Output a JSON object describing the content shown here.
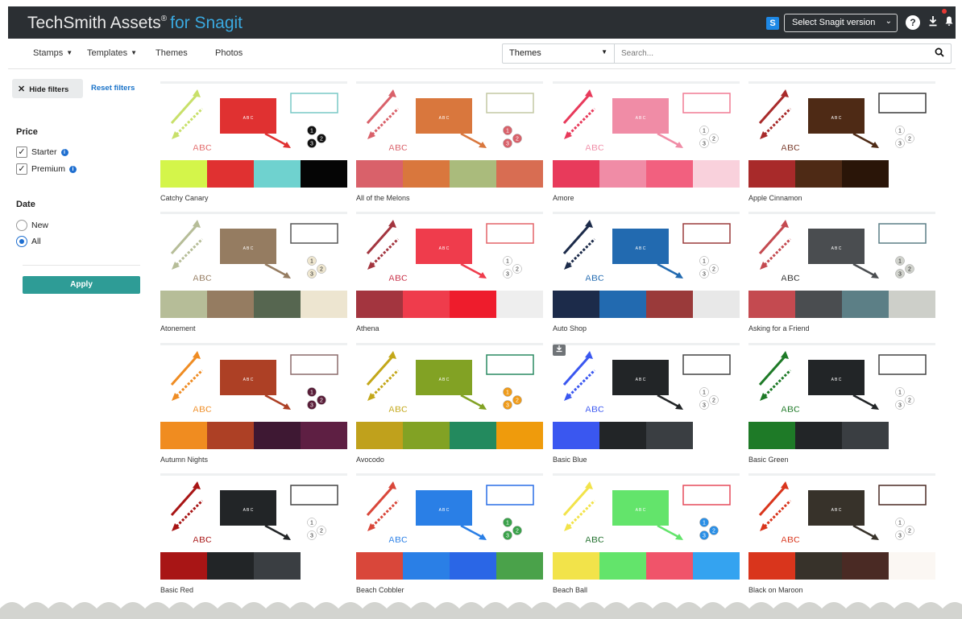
{
  "header": {
    "brand": "TechSmith Assets",
    "brand_reg": "®",
    "brand_suffix": "for Snagit",
    "snagit_badge": "S",
    "version_select": "Select Snagit version",
    "icons": [
      "snagit-logo-icon",
      "chevron-down-icon",
      "help-icon",
      "download-icon",
      "notification-bell-icon"
    ]
  },
  "nav": {
    "items": [
      {
        "label": "Stamps",
        "has_menu": true
      },
      {
        "label": "Templates",
        "has_menu": true
      },
      {
        "label": "Themes",
        "has_menu": false
      },
      {
        "label": "Photos",
        "has_menu": false
      }
    ],
    "search_type": "Themes",
    "search_placeholder": "Search..."
  },
  "sidebar": {
    "hide_filters": "Hide filters",
    "reset_filters": "Reset filters",
    "price_title": "Price",
    "price_options": [
      {
        "label": "Starter",
        "checked": true
      },
      {
        "label": "Premium",
        "checked": true
      }
    ],
    "date_title": "Date",
    "date_options": [
      {
        "label": "New",
        "selected": false
      },
      {
        "label": "All",
        "selected": true
      }
    ],
    "apply": "Apply"
  },
  "themes": [
    {
      "name": "Catchy Canary",
      "arrow": "#c8e06a",
      "box": "#e03131",
      "outline": "#78c8c6",
      "step": "#111111",
      "text": "#e26a6a",
      "colors": [
        "#d4f54a",
        "#e03131",
        "#6fd2cf",
        "#050505"
      ]
    },
    {
      "name": "All of the Melons",
      "arrow": "#d9616a",
      "box": "#d9773d",
      "outline": "#c3c9a4",
      "step": "#d9616a",
      "text": "#d9616a",
      "colors": [
        "#d9616a",
        "#d9773d",
        "#aabb7c",
        "#d86d52"
      ]
    },
    {
      "name": "Amore",
      "arrow": "#e83a5b",
      "box": "#f08ca6",
      "outline": "#f07a93",
      "step": "#ffffff",
      "text": "#f08ca6",
      "colors": [
        "#e83a5b",
        "#f08ca6",
        "#f2607f",
        "#f9d1dc"
      ]
    },
    {
      "name": "Apple Cinnamon",
      "arrow": "#a82a2a",
      "box": "#4e2a15",
      "outline": "#3a3a3a",
      "step": "#ffffff",
      "text": "#7a3b2b",
      "colors": [
        "#a82a2a",
        "#4e2a15",
        "#2a1508",
        "#ffffff"
      ]
    },
    {
      "name": "Atonement",
      "arrow": "#b6bd98",
      "box": "#957c61",
      "outline": "#555555",
      "step": "#eee6cf",
      "text": "#957c61",
      "colors": [
        "#b6bd98",
        "#957c61",
        "#566650",
        "#ede5d0"
      ]
    },
    {
      "name": "Athena",
      "arrow": "#a3353f",
      "box": "#ef3c4c",
      "outline": "#e36468",
      "step": "#ffffff",
      "text": "#c9334a",
      "colors": [
        "#a3353f",
        "#ef3c4c",
        "#ee1c2c",
        "#eeeeee"
      ]
    },
    {
      "name": "Auto Shop",
      "arrow": "#1c2b4a",
      "box": "#226ab0",
      "outline": "#9a3a3a",
      "step": "#ffffff",
      "text": "#226ab0",
      "colors": [
        "#1c2b4a",
        "#226ab0",
        "#9a3a3a",
        "#e8e8e8"
      ]
    },
    {
      "name": "Asking for a Friend",
      "arrow": "#c44a50",
      "box": "#4a4d50",
      "outline": "#5c7f86",
      "step": "#d0d2cc",
      "text": "#333333",
      "colors": [
        "#c44a50",
        "#4a4d50",
        "#5c7f86",
        "#cdcfc9"
      ]
    },
    {
      "name": "Autumn Nights",
      "arrow": "#ef8c23",
      "box": "#ad4025",
      "outline": "#8b6b6b",
      "step": "#5a1e39",
      "text": "#ef8c23",
      "colors": [
        "#f08c20",
        "#ad4025",
        "#3e1833",
        "#5e1f43"
      ]
    },
    {
      "name": "Avocodo",
      "arrow": "#c3a719",
      "box": "#82a224",
      "outline": "#2a8a62",
      "step": "#ef9b1a",
      "text": "#c3a719",
      "colors": [
        "#c0a11c",
        "#82a224",
        "#238a5e",
        "#ef9b0c"
      ]
    },
    {
      "name": "Basic Blue",
      "arrow": "#3a57f0",
      "box": "#222527",
      "outline": "#444444",
      "step": "#ffffff",
      "text": "#3a57f0",
      "colors": [
        "#3a57f0",
        "#222527",
        "#3a3e42",
        "#ffffff"
      ],
      "download": true
    },
    {
      "name": "Basic Green",
      "arrow": "#1e7a27",
      "box": "#222527",
      "outline": "#444444",
      "step": "#ffffff",
      "text": "#1e7a27",
      "colors": [
        "#1e7a27",
        "#222527",
        "#3a3e42",
        "#ffffff"
      ]
    },
    {
      "name": "Basic Red",
      "arrow": "#a81515",
      "box": "#222527",
      "outline": "#444444",
      "step": "#ffffff",
      "text": "#a81515",
      "colors": [
        "#a81515",
        "#222527",
        "#3a3e42",
        "#ffffff"
      ]
    },
    {
      "name": "Beach Cobbler",
      "arrow": "#d9473a",
      "box": "#2a7fe6",
      "outline": "#2a6fe6",
      "step": "#3aa24a",
      "text": "#2a7fe6",
      "colors": [
        "#d9473a",
        "#2a7fe6",
        "#2a66e6",
        "#4aa24a"
      ]
    },
    {
      "name": "Beach Ball",
      "arrow": "#f2e34a",
      "box": "#63e46b",
      "outline": "#e64a5a",
      "step": "#2a8fe6",
      "text": "#1e6e2a",
      "colors": [
        "#f2e34a",
        "#63e46b",
        "#f0546a",
        "#34a3f0"
      ]
    },
    {
      "name": "Black on Maroon",
      "arrow": "#d9351c",
      "box": "#37322a",
      "outline": "#4a2a24",
      "step": "#ffffff",
      "text": "#d9351c",
      "colors": [
        "#d9351c",
        "#37322a",
        "#4a2a24",
        "#fbf7f3"
      ]
    }
  ]
}
